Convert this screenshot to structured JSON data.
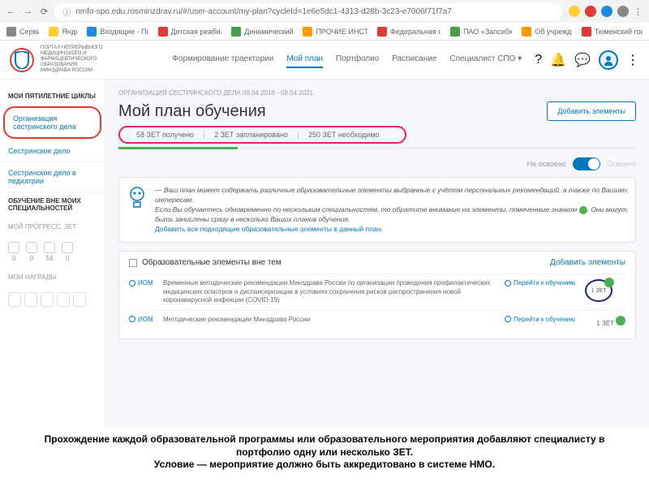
{
  "browser": {
    "url": "nmfo-spo.edu.rosminzdrav.ru/#/user-account/my-plan?cycleId=1e6e5dc1-4313-d28b-3c23-e7006f71f7a7"
  },
  "bookmarks": [
    {
      "label": "Сервисы",
      "color": "#888"
    },
    {
      "label": "Яндекс",
      "color": "#fc3"
    },
    {
      "label": "Входящие - Почта...",
      "color": "#1e88e5"
    },
    {
      "label": "Детская реабилита...",
      "color": "#e53935"
    },
    {
      "label": "Динамический тре...",
      "color": "#43a047"
    },
    {
      "label": "ПРОЧИЕ ИНСТРУК...",
      "color": "#ff9800"
    },
    {
      "label": "Федеральная служ...",
      "color": "#e53935"
    },
    {
      "label": "ПАО «Запсибкомб...",
      "color": "#43a047"
    },
    {
      "label": "Об учреждении",
      "color": "#ff9800"
    },
    {
      "label": "Тюменский госуда...",
      "color": "#e53935"
    }
  ],
  "portal": {
    "title": "ПОРТАЛ НЕПРЕРЫВНОГО МЕДИЦИНСКОГО И ФАРМАЦЕВТИЧЕСКОГО ОБРАЗОВАНИЯ МИНЗДРАВА РОССИИ"
  },
  "topnav": [
    {
      "label": "Формирование траектории"
    },
    {
      "label": "Мой план"
    },
    {
      "label": "Портфолио"
    },
    {
      "label": "Расписание"
    },
    {
      "label": "Специалист СПО ▾"
    }
  ],
  "sidebar": {
    "heading1": "МОИ ПЯТИЛЕТНИЕ ЦИКЛЫ",
    "items": [
      {
        "label": "Организация сестринского дела"
      },
      {
        "label": "Сестринское дело"
      },
      {
        "label": "Сестринское дело в педиатрии"
      }
    ],
    "heading2": "ОБУЧЕНИЕ ВНЕ МОИХ СПЕЦИАЛЬНОСТЕЙ",
    "progress_label": "МОЙ ПРОГРЕСС, ЗЕТ",
    "progress": [
      {
        "val": "0"
      },
      {
        "val": "0"
      },
      {
        "val": "58"
      },
      {
        "val": "0"
      }
    ],
    "awards_label": "МОИ НАГРАДЫ"
  },
  "content": {
    "org_line": "ОРГАНИЗАЦИЯ СЕСТРИНСКОГО ДЕЛА 09.04.2016 - 08.04.2021",
    "title": "Мой план обучения",
    "add_button": "Добавить элементы",
    "zet_stats": [
      "58 ЗЕТ получено",
      "2 ЗЕТ запланировано",
      "250 ЗЕТ необходимо"
    ],
    "toggle_left": "Не освоено",
    "toggle_right": "Освоено",
    "info": {
      "line1": "— Ваш план может содержать различные образовательные элементы выбранные с учётом персональных рекомендаций, а также по Вашим интересам.",
      "line2_a": "Если Вы обучаетесь одновременно по нескольким специальностям, то обратите внимание на элементы, помеченные значком ",
      "line2_b": ". Они могут быть зачислены сразу в несколько Ваших планов обучения.",
      "link": "Добавить все подходящие образовательные элементы в данный план."
    },
    "elements_title": "Образовательные элементы вне тем",
    "elements_add": "Добавить элементы",
    "rows": [
      {
        "tag": "ИОМ",
        "desc": "Временные методические рекомендации Минздрава России по организации проведения профилактических медицинских осмотров и диспансеризации в условиях сохранения рисков распространения новой коронавирусной инфекции (COVID-19)",
        "link": "Перейти к обучению",
        "zet": "1 ЗЕТ"
      },
      {
        "tag": "ИОМ",
        "desc": "Методические рекомендации Минздрава России",
        "link": "Перейти к обучению",
        "zet": "1 ЗЕТ"
      }
    ]
  },
  "caption": {
    "line1": "Прохождение каждой образовательной программы или образовательного мероприятия добавляют специалисту в портфолио одну или несколько ЗЕТ.",
    "line2": "Условие — мероприятие должно быть аккредитовано в системе НМО."
  }
}
